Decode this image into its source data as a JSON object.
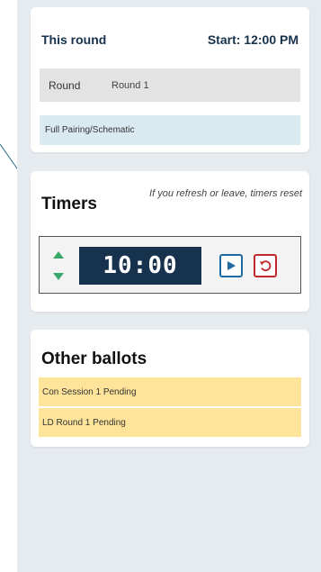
{
  "this_round": {
    "title": "This round",
    "start": "Start: 12:00 PM",
    "round_label": "Round",
    "round_value": "Round 1",
    "pairing_link": "Full Pairing/Schematic"
  },
  "timers": {
    "title": "Timers",
    "note": "If you refresh or leave, timers reset",
    "time": "10:00",
    "icons": {
      "stepper": "up-down-arrows-icon",
      "play": "play-icon",
      "reset": "reset-icon"
    },
    "colors": {
      "display_bg": "#17324d",
      "play": "#1f6aa0",
      "reset": "#c0292b",
      "stepper": "#3aa86b"
    }
  },
  "other_ballots": {
    "title": "Other ballots",
    "items": [
      {
        "label": "Con Session 1 Pending"
      },
      {
        "label": "LD Round 1 Pending"
      }
    ],
    "pending_color": "#fde49a"
  }
}
